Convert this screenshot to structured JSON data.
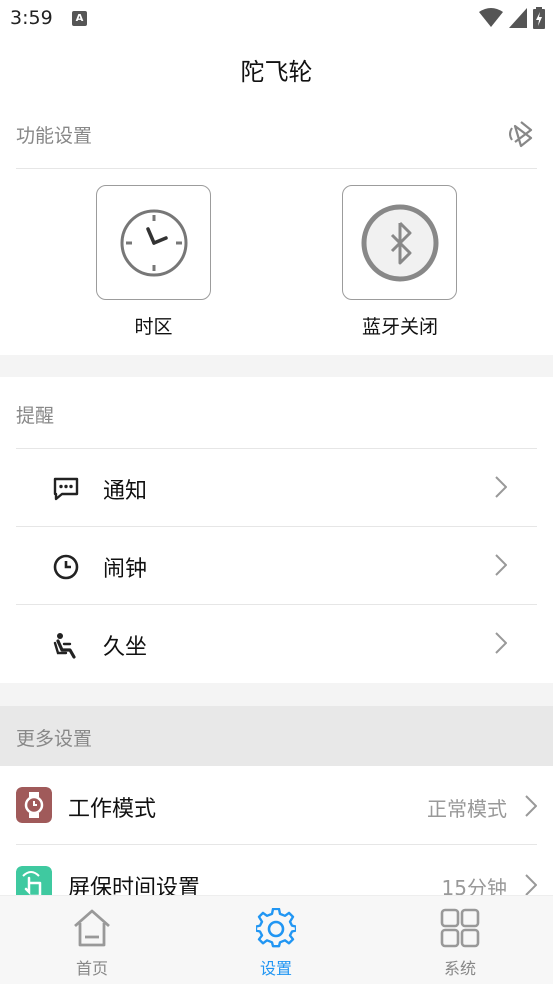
{
  "status_bar": {
    "time": "3:59",
    "notif_letter": "A"
  },
  "app": {
    "title": "陀飞轮"
  },
  "function_settings": {
    "header": "功能设置",
    "items": [
      {
        "label": "时区",
        "icon": "clock-icon"
      },
      {
        "label": "蓝牙关闭",
        "icon": "bluetooth-icon"
      }
    ]
  },
  "reminders": {
    "header": "提醒",
    "items": [
      {
        "label": "通知",
        "icon": "message-icon"
      },
      {
        "label": "闹钟",
        "icon": "alarm-clock-icon"
      },
      {
        "label": "久坐",
        "icon": "sitting-icon"
      }
    ]
  },
  "more_settings": {
    "header": "更多设置",
    "items": [
      {
        "label": "工作模式",
        "value": "正常模式",
        "icon": "watch-icon",
        "icon_color": "#a05a5a"
      },
      {
        "label": "屏保时间设置",
        "value": "15分钟",
        "icon": "touch-icon",
        "icon_color": "#3fc9a0"
      }
    ]
  },
  "bottom_nav": {
    "items": [
      {
        "label": "首页",
        "icon": "home-icon",
        "active": false
      },
      {
        "label": "设置",
        "icon": "gear-icon",
        "active": true
      },
      {
        "label": "系统",
        "icon": "grid-icon",
        "active": false
      }
    ]
  },
  "colors": {
    "accent": "#2196f3",
    "band": "#f4f4f4",
    "more_header_bg": "#e8e8e8"
  }
}
